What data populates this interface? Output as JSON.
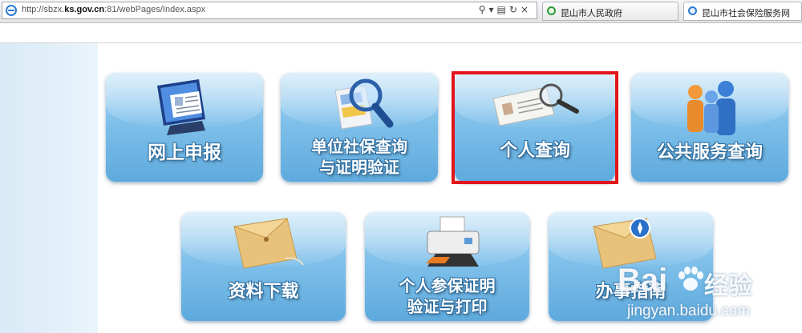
{
  "browser": {
    "url_prefix": "http://sbzx.",
    "url_domain": "ks.gov.cn",
    "url_suffix": ":81/webPages/Index.aspx",
    "tabs": [
      {
        "label": "昆山市人民政府"
      },
      {
        "label": "昆山市社会保险服务网"
      }
    ]
  },
  "tiles": {
    "online": {
      "line1": "网上申报",
      "line2": ""
    },
    "unit": {
      "line1": "单位社保查询",
      "line2": "与证明验证"
    },
    "personal": {
      "line1": "个人查询",
      "line2": ""
    },
    "public": {
      "line1": "公共服务查询",
      "line2": ""
    },
    "download": {
      "line1": "资料下载",
      "line2": ""
    },
    "print": {
      "line1": "个人参保证明",
      "line2": "验证与打印"
    },
    "guide": {
      "line1": "办事指南",
      "line2": ""
    }
  },
  "watermark": {
    "brand": "Bai",
    "brand_cn": "经验",
    "site": "jingyan.baidu.com"
  },
  "colors": {
    "highlight": "#e2141c",
    "tile_top": "#b7def6",
    "tile_bottom": "#5eaadd"
  }
}
